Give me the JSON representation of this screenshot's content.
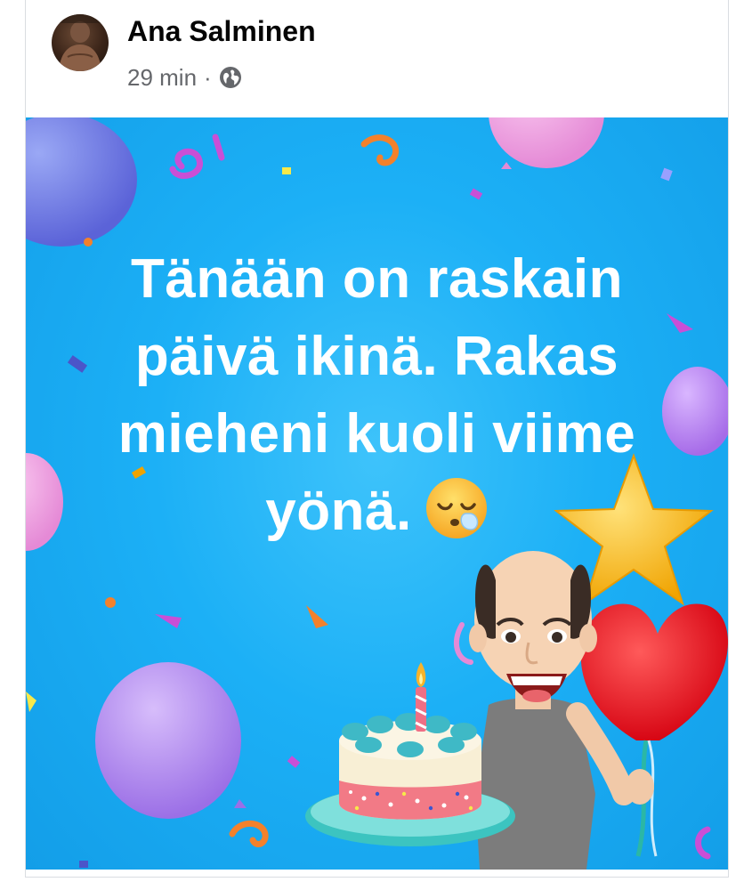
{
  "post": {
    "author": "Ana Salminen",
    "time": "29 min",
    "separator": "·",
    "audience_icon": "globe-icon",
    "text": "Tänään on raskain\npäivä ikinä. Rakas\nmieheni kuoli viime\nyönä.",
    "emoji": "sleepy-face-emoji",
    "background_theme": "birthday-celebration",
    "background_color": "#1cb0f6"
  }
}
